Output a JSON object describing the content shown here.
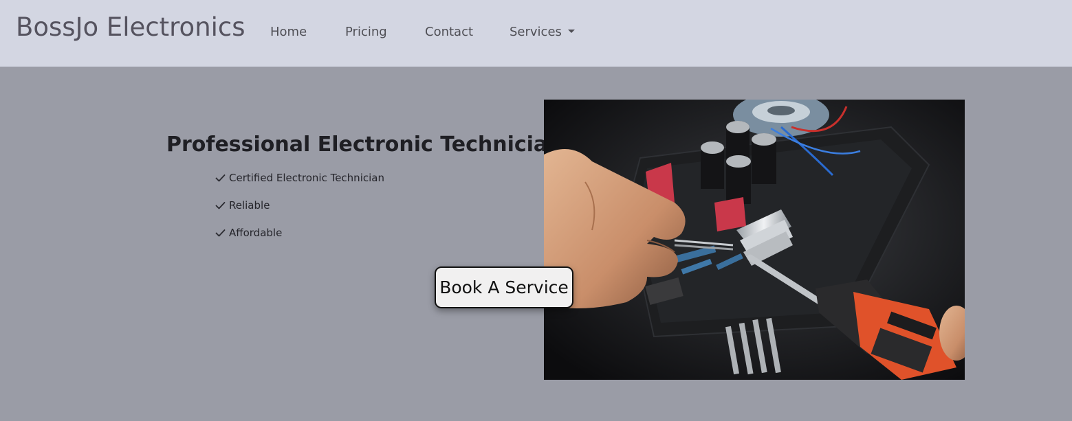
{
  "navbar": {
    "brand": "BossJo Electronics",
    "links": [
      {
        "label": "Home"
      },
      {
        "label": "Pricing"
      },
      {
        "label": "Contact"
      },
      {
        "label": "Services",
        "dropdown": true
      }
    ]
  },
  "hero": {
    "title": "Professional Electronic Technician",
    "features": [
      "Certified Electronic Technician",
      "Reliable",
      "Affordable"
    ],
    "book_button": "Book A Service",
    "check_icon": "checkmark-icon"
  },
  "colors": {
    "navbar_bg": "#d3d6e2",
    "page_bg": "#9a9ca6",
    "brand_text": "#55535f",
    "nav_text": "#4f4f55",
    "button_bg": "#f1f0f0"
  }
}
